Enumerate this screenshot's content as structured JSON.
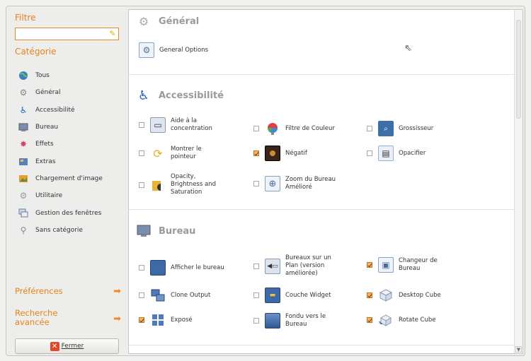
{
  "sidebar": {
    "filter_heading": "Filtre",
    "filter_value": "",
    "category_heading": "Catégorie",
    "categories": [
      {
        "label": "Tous",
        "icon": "globe-icon"
      },
      {
        "label": "Général",
        "icon": "gear-icon"
      },
      {
        "label": "Accessibilité",
        "icon": "accessibility-icon"
      },
      {
        "label": "Bureau",
        "icon": "desktop-icon"
      },
      {
        "label": "Effets",
        "icon": "effects-icon"
      },
      {
        "label": "Extras",
        "icon": "extras-icon"
      },
      {
        "label": "Chargement d'image",
        "icon": "image-loading-icon"
      },
      {
        "label": "Utilitaire",
        "icon": "utility-icon"
      },
      {
        "label": "Gestion des fenêtres",
        "icon": "window-management-icon"
      },
      {
        "label": "Sans catégorie",
        "icon": "uncategorized-icon"
      }
    ],
    "preferences_label": "Préférences",
    "advanced_search_label": "Recherche avancée",
    "close_label": "Fermer"
  },
  "main": {
    "sections": {
      "general": {
        "title": "Général",
        "plugins": [
          {
            "label": "General Options"
          }
        ]
      },
      "accessibility": {
        "title": "Accessibilité",
        "plugins": [
          {
            "label": "Aide à la concentration",
            "checked": false
          },
          {
            "label": "Filtre de Couleur",
            "checked": false
          },
          {
            "label": "Grossisseur",
            "checked": false
          },
          {
            "label": "Montrer le pointeur",
            "checked": false
          },
          {
            "label": "Négatif",
            "checked": true
          },
          {
            "label": "Opacifier",
            "checked": false
          },
          {
            "label": "Opacity, Brightness and Saturation",
            "checked": false
          },
          {
            "label": "Zoom du Bureau Amélioré",
            "checked": false
          }
        ]
      },
      "desktop": {
        "title": "Bureau",
        "plugins": [
          {
            "label": "Afficher le bureau",
            "checked": false
          },
          {
            "label": "Bureaux sur un Plan (version améliorée)",
            "checked": false
          },
          {
            "label": "Changeur de Bureau",
            "checked": true
          },
          {
            "label": "Clone Output",
            "checked": false
          },
          {
            "label": "Couche Widget",
            "checked": false
          },
          {
            "label": "Desktop Cube",
            "checked": true
          },
          {
            "label": "Exposé",
            "checked": true
          },
          {
            "label": "Fondu vers le Bureau",
            "checked": false
          },
          {
            "label": "Rotate Cube",
            "checked": true
          }
        ]
      }
    }
  }
}
